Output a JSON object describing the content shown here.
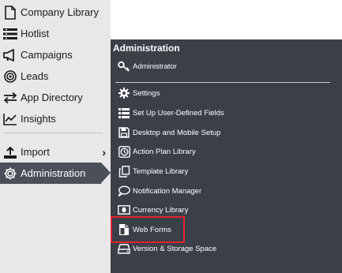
{
  "sidebar": {
    "items": [
      {
        "label": "Company Library",
        "icon": "document-icon"
      },
      {
        "label": "Hotlist",
        "icon": "list-icon"
      },
      {
        "label": "Campaigns",
        "icon": "megaphone-icon"
      },
      {
        "label": "Leads",
        "icon": "target-icon"
      },
      {
        "label": "App Directory",
        "icon": "transfer-arrows-icon"
      },
      {
        "label": "Insights",
        "icon": "chart-line-icon"
      },
      {
        "label": "Import",
        "icon": "upload-icon"
      },
      {
        "label": "Administration",
        "icon": "gear-icon"
      }
    ],
    "active_item": "Administration",
    "active_color": "#4a4f5a"
  },
  "flyout": {
    "title": "Administration",
    "items": [
      {
        "label": "Administrator",
        "icon": "key-icon"
      },
      {
        "label": "Settings",
        "icon": "gear-icon"
      },
      {
        "label": "Set Up User-Defined Fields",
        "icon": "list-icon"
      },
      {
        "label": "Desktop and Mobile Setup",
        "icon": "save-icon"
      },
      {
        "label": "Action Plan Library",
        "icon": "clock-icon"
      },
      {
        "label": "Template Library",
        "icon": "copy-icon"
      },
      {
        "label": "Notification Manager",
        "icon": "speech-bubble-icon"
      },
      {
        "label": "Currency Library",
        "icon": "money-icon"
      },
      {
        "label": "Web Forms",
        "icon": "document-icon"
      },
      {
        "label": "Version & Storage Space",
        "icon": "drive-icon"
      }
    ],
    "highlighted_item": "Web Forms",
    "highlight_color": "#e0242f",
    "background": "#3a3f48"
  }
}
